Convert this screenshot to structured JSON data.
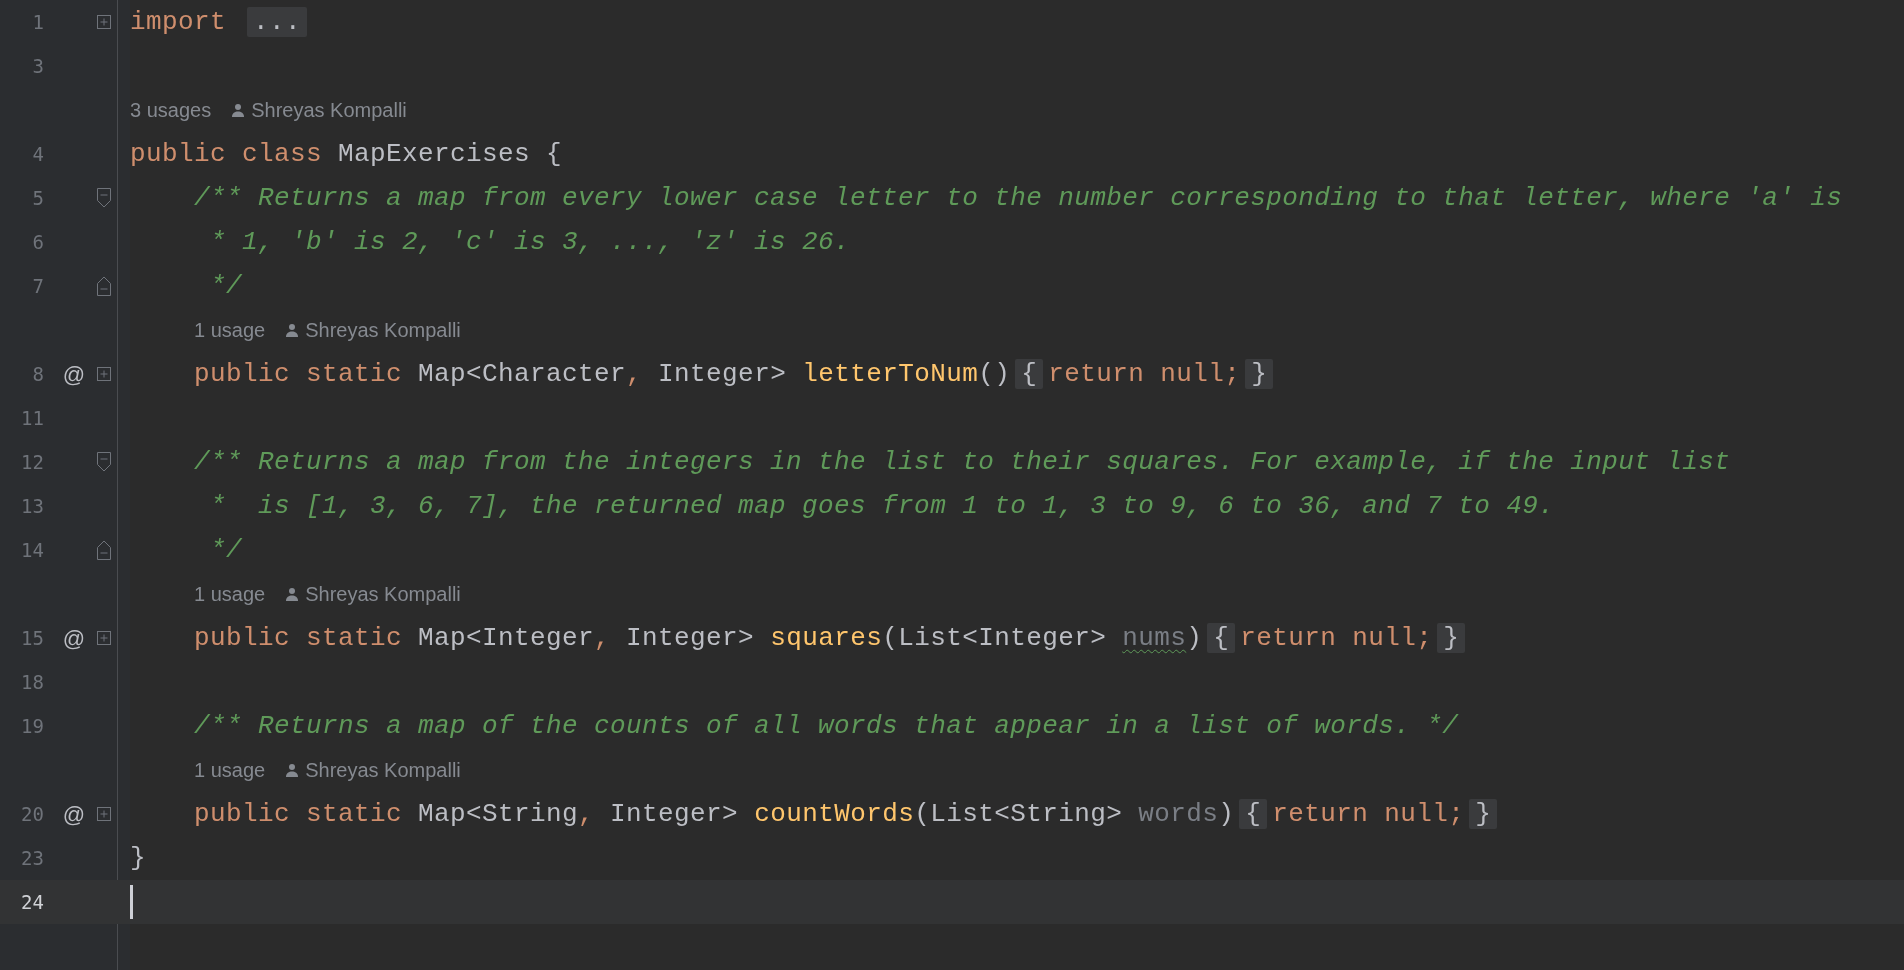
{
  "editor": {
    "lines": [
      {
        "kind": "code",
        "number": "1",
        "fold": {
          "kind": "expand"
        },
        "tokens": [
          {
            "text": "import ",
            "kind": "keyword"
          },
          {
            "text": "...",
            "kind": "folded"
          }
        ]
      },
      {
        "kind": "code",
        "number": "3"
      },
      {
        "kind": "hint",
        "usages": "3 usages",
        "author": "Shreyas Kompalli"
      },
      {
        "kind": "code",
        "number": "4",
        "tokens": [
          {
            "text": "public class ",
            "kind": "keyword"
          },
          {
            "text": "MapExercises {",
            "kind": "plain"
          }
        ]
      },
      {
        "kind": "code",
        "number": "5",
        "fold": {
          "kind": "start"
        },
        "tokens": [
          {
            "text": "    /** Returns a map from every lower case letter to the number corresponding to that letter, where 'a' is",
            "kind": "comment"
          }
        ]
      },
      {
        "kind": "code",
        "number": "6",
        "tokens": [
          {
            "text": "     * 1, 'b' is 2, 'c' is 3, ..., 'z' is 26.",
            "kind": "comment"
          }
        ]
      },
      {
        "kind": "code",
        "number": "7",
        "fold": {
          "kind": "end"
        },
        "tokens": [
          {
            "text": "     */",
            "kind": "comment"
          }
        ]
      },
      {
        "kind": "hint",
        "usages": "1 usage",
        "author": "Shreyas Kompalli"
      },
      {
        "kind": "code",
        "number": "8",
        "gutter_mark": "@",
        "fold": {
          "kind": "expand"
        },
        "tokens": [
          {
            "text": "    public static ",
            "kind": "keyword"
          },
          {
            "text": "Map<Character",
            "kind": "plain"
          },
          {
            "text": ",",
            "kind": "keyword"
          },
          {
            "text": " Integer> ",
            "kind": "plain"
          },
          {
            "text": "letterToNum",
            "kind": "method"
          },
          {
            "text": "()",
            "kind": "plain"
          },
          {
            "text": "{",
            "kind": "folded"
          },
          {
            "text": "return null;",
            "kind": "keyword"
          },
          {
            "text": "}",
            "kind": "folded"
          }
        ]
      },
      {
        "kind": "code",
        "number": "11"
      },
      {
        "kind": "code",
        "number": "12",
        "fold": {
          "kind": "start"
        },
        "tokens": [
          {
            "text": "    /** Returns a map from the integers in the list to their squares. For example, if the input list",
            "kind": "comment"
          }
        ]
      },
      {
        "kind": "code",
        "number": "13",
        "tokens": [
          {
            "text": "     *  is [1, 3, 6, 7], the returned map goes from 1 to 1, 3 to 9, 6 to 36, and 7 to 49.",
            "kind": "comment"
          }
        ]
      },
      {
        "kind": "code",
        "number": "14",
        "fold": {
          "kind": "end"
        },
        "tokens": [
          {
            "text": "     */",
            "kind": "comment"
          }
        ]
      },
      {
        "kind": "hint",
        "usages": "1 usage",
        "author": "Shreyas Kompalli"
      },
      {
        "kind": "code",
        "number": "15",
        "gutter_mark": "@",
        "fold": {
          "kind": "expand"
        },
        "tokens": [
          {
            "text": "    public static ",
            "kind": "keyword"
          },
          {
            "text": "Map<Integer",
            "kind": "plain"
          },
          {
            "text": ",",
            "kind": "keyword"
          },
          {
            "text": " Integer> ",
            "kind": "plain"
          },
          {
            "text": "squares",
            "kind": "method"
          },
          {
            "text": "(List<Integer> ",
            "kind": "plain"
          },
          {
            "text": "nums",
            "kind": "unused",
            "typo": true
          },
          {
            "text": ")",
            "kind": "plain"
          },
          {
            "text": "{",
            "kind": "folded"
          },
          {
            "text": "return null;",
            "kind": "keyword"
          },
          {
            "text": "}",
            "kind": "folded"
          }
        ]
      },
      {
        "kind": "code",
        "number": "18"
      },
      {
        "kind": "code",
        "number": "19",
        "tokens": [
          {
            "text": "    /** Returns a map of the counts of all words that appear in a list of words. */",
            "kind": "comment"
          }
        ]
      },
      {
        "kind": "hint",
        "usages": "1 usage",
        "author": "Shreyas Kompalli"
      },
      {
        "kind": "code",
        "number": "20",
        "gutter_mark": "@",
        "fold": {
          "kind": "expand"
        },
        "tokens": [
          {
            "text": "    public static ",
            "kind": "keyword"
          },
          {
            "text": "Map<String",
            "kind": "plain"
          },
          {
            "text": ",",
            "kind": "keyword"
          },
          {
            "text": " Integer> ",
            "kind": "plain"
          },
          {
            "text": "countWords",
            "kind": "method"
          },
          {
            "text": "(List<String> ",
            "kind": "plain"
          },
          {
            "text": "words",
            "kind": "unused",
            "typo": false
          },
          {
            "text": ")",
            "kind": "plain"
          },
          {
            "text": "{",
            "kind": "folded"
          },
          {
            "text": "return null;",
            "kind": "keyword"
          },
          {
            "text": "}",
            "kind": "folded"
          }
        ]
      },
      {
        "kind": "code",
        "number": "23",
        "tokens": [
          {
            "text": "}",
            "kind": "plain"
          }
        ]
      },
      {
        "kind": "code",
        "number": "24",
        "current": true
      }
    ]
  }
}
